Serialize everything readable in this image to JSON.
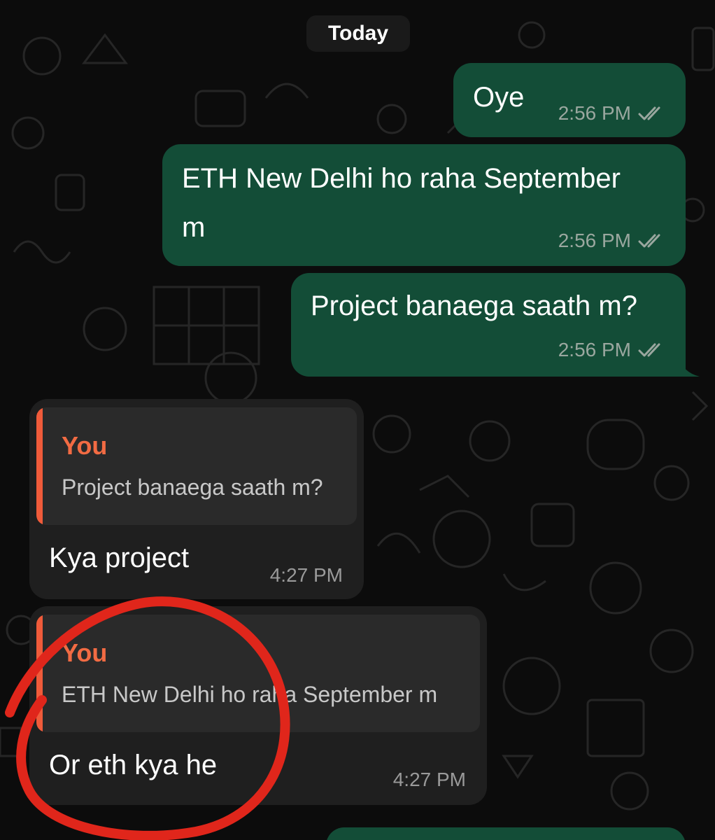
{
  "date_separator": "Today",
  "messages": [
    {
      "id": "m1",
      "direction": "outgoing",
      "text": "Oye",
      "time": "2:56 PM",
      "status": "read"
    },
    {
      "id": "m2",
      "direction": "outgoing",
      "text_line1": "ETH New Delhi ho raha September",
      "text_line2": "m",
      "time": "2:56 PM",
      "status": "read"
    },
    {
      "id": "m3",
      "direction": "outgoing",
      "text": "Project banaega saath m?",
      "time": "2:56 PM",
      "status": "read"
    },
    {
      "id": "m4",
      "direction": "incoming",
      "quote": {
        "author": "You",
        "text": "Project banaega saath m?"
      },
      "text": "Kya project",
      "time": "4:27 PM"
    },
    {
      "id": "m5",
      "direction": "incoming",
      "quote": {
        "author": "You",
        "text": "ETH New Delhi ho raha September m"
      },
      "text": "Or eth kya he",
      "time": "4:27 PM",
      "highlighted": true
    }
  ],
  "colors": {
    "outgoing_bubble": "#134d37",
    "incoming_bubble": "#1f1f1f",
    "quote_accent": "#f05b3a",
    "annotation": "#e0261b"
  },
  "icons": {
    "read_status": "double-check-icon"
  }
}
